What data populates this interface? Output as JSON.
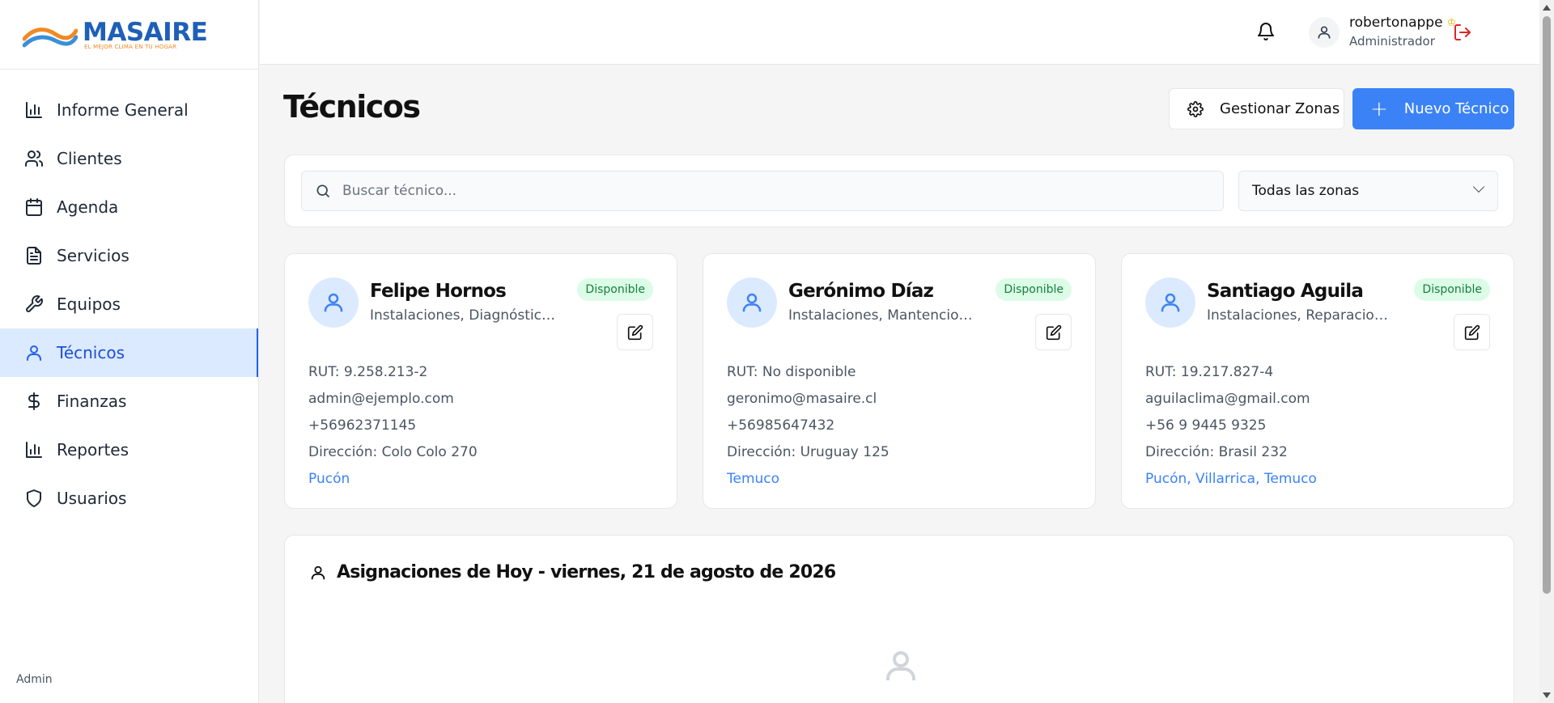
{
  "brand": {
    "name_part1": "MAS",
    "name_part2": "AIRE",
    "tagline": "EL MEJOR CLIMA EN TU HOGAR"
  },
  "sidebar": {
    "items": [
      {
        "label": "Informe General",
        "icon": "bar-chart-icon"
      },
      {
        "label": "Clientes",
        "icon": "users-icon"
      },
      {
        "label": "Agenda",
        "icon": "calendar-icon"
      },
      {
        "label": "Servicios",
        "icon": "file-text-icon"
      },
      {
        "label": "Equipos",
        "icon": "wrench-icon"
      },
      {
        "label": "Técnicos",
        "icon": "user-icon",
        "active": true
      },
      {
        "label": "Finanzas",
        "icon": "dollar-icon"
      },
      {
        "label": "Reportes",
        "icon": "bar-chart-icon"
      },
      {
        "label": "Usuarios",
        "icon": "shield-icon"
      }
    ],
    "footer": "Admin"
  },
  "header": {
    "user_name": "robertonappe",
    "user_role": "Administrador"
  },
  "page": {
    "title": "Técnicos",
    "manage_zones_label": "Gestionar Zonas",
    "new_tech_label": "Nuevo Técnico",
    "search_placeholder": "Buscar técnico...",
    "zone_filter_value": "Todas las zonas"
  },
  "technicians": [
    {
      "name": "Felipe Hornos",
      "skills": "Instalaciones, Diagnóstico, Mantenciones",
      "status": "Disponible",
      "rut": "RUT: 9.258.213-2",
      "email": "admin@ejemplo.com",
      "phone": "+56962371145",
      "address": "Dirección: Colo Colo 270",
      "zones": "Pucón"
    },
    {
      "name": "Gerónimo Díaz",
      "skills": "Instalaciones, Mantenciones, Reparaciones",
      "status": "Disponible",
      "rut": "RUT: No disponible",
      "email": "geronimo@masaire.cl",
      "phone": "+56985647432",
      "address": "Dirección: Uruguay 125",
      "zones": "Temuco"
    },
    {
      "name": "Santiago Aguila",
      "skills": "Instalaciones, Reparaciones, Mantenciones",
      "status": "Disponible",
      "rut": "RUT: 19.217.827-4",
      "email": "aguilaclima@gmail.com",
      "phone": "+56 9 9445 9325",
      "address": "Dirección: Brasil 232",
      "zones": "Pucón, Villarrica, Temuco"
    }
  ],
  "assignments": {
    "title": "Asignaciones de Hoy - viernes, 21 de agosto de 2026"
  },
  "colors": {
    "accent": "#3b82f6",
    "active_bg": "#dbeafe",
    "status_green": "#15803d",
    "logout_red": "#dc2626",
    "brand_orange": "#f08a24",
    "brand_blue": "#1e5fb8"
  }
}
